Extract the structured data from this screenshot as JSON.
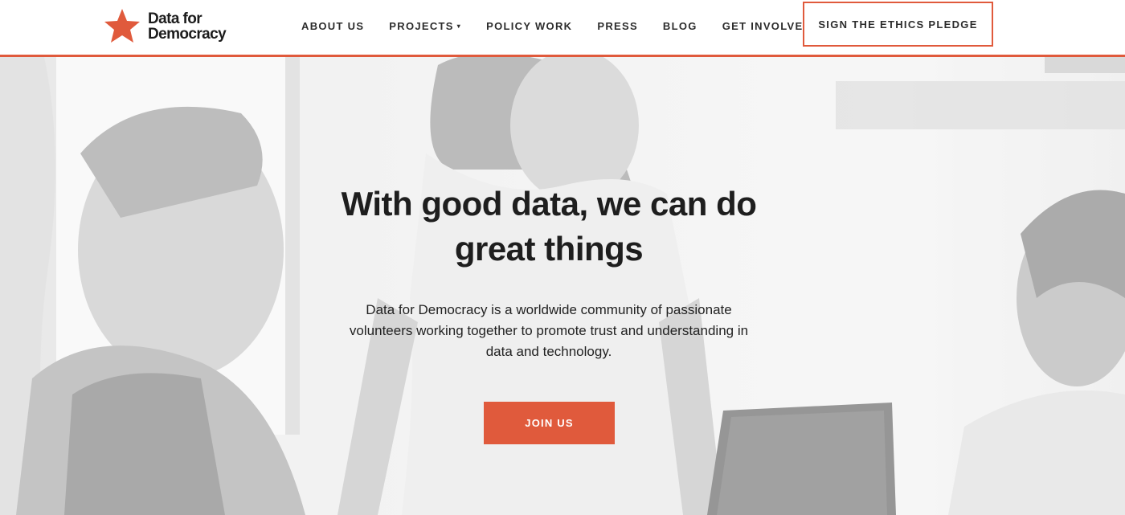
{
  "header": {
    "logo": {
      "line1": "Data for",
      "line2": "Democracy",
      "icon": "star-icon",
      "color": "#e05a3c"
    },
    "nav": [
      {
        "label": "ABOUT US",
        "has_dropdown": false
      },
      {
        "label": "PROJECTS",
        "has_dropdown": true
      },
      {
        "label": "POLICY WORK",
        "has_dropdown": false
      },
      {
        "label": "PRESS",
        "has_dropdown": false
      },
      {
        "label": "BLOG",
        "has_dropdown": false
      },
      {
        "label": "GET INVOLVED",
        "has_dropdown": true
      }
    ],
    "dropdown_icon": "▾",
    "pledge_label": "SIGN THE ETHICS PLEDGE"
  },
  "hero": {
    "title": "With good data, we can do great things",
    "description": "Data for Democracy is a worldwide community of passionate volunteers working together to promote trust and understanding in data and technology.",
    "cta_label": "JOIN US"
  },
  "colors": {
    "accent": "#e05a3c",
    "text": "#1e1e1e",
    "background": "#ffffff"
  }
}
